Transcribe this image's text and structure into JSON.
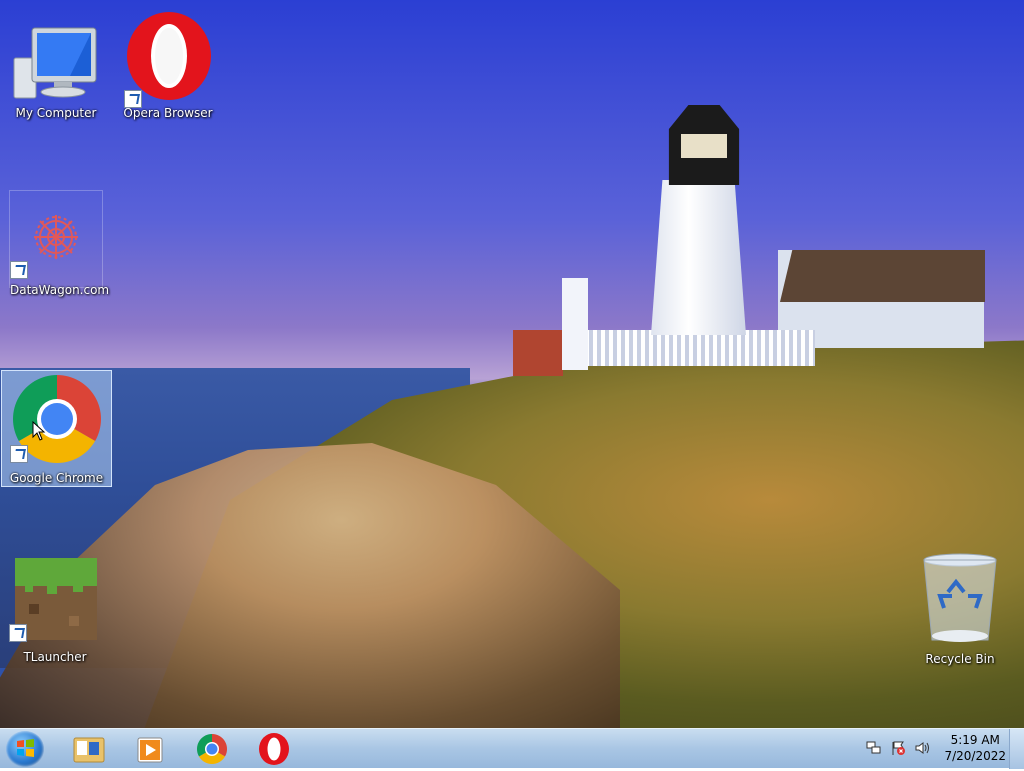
{
  "desktop": {
    "icons": [
      {
        "name": "my-computer",
        "label": "My Computer",
        "icon": "computer-icon"
      },
      {
        "name": "opera-browser",
        "label": "Opera Browser",
        "icon": "opera-icon",
        "shortcut": true
      },
      {
        "name": "datawagon",
        "label": "DataWagon.com",
        "icon": "datawagon-icon",
        "shortcut": true
      },
      {
        "name": "google-chrome",
        "label": "Google Chrome",
        "icon": "chrome-icon",
        "shortcut": true,
        "selected": true
      },
      {
        "name": "tlauncher",
        "label": "TLauncher",
        "icon": "minecraft-grass-block-icon",
        "shortcut": true
      },
      {
        "name": "recycle-bin",
        "label": "Recycle Bin",
        "icon": "recycle-bin-icon"
      }
    ]
  },
  "taskbar": {
    "start": "windows-start-icon",
    "pinned": [
      {
        "name": "file-explorer",
        "icon": "folder-icon"
      },
      {
        "name": "media-player",
        "icon": "media-player-icon"
      },
      {
        "name": "chrome",
        "icon": "chrome-icon"
      },
      {
        "name": "opera",
        "icon": "opera-icon"
      }
    ],
    "tray": [
      {
        "name": "network",
        "icon": "network-icon"
      },
      {
        "name": "action-center",
        "icon": "action-center-flag-icon"
      },
      {
        "name": "volume",
        "icon": "volume-icon"
      }
    ],
    "clock": {
      "time": "5:19 AM",
      "date": "7/20/2022"
    }
  },
  "colors": {
    "taskbar": "#a9c6e4",
    "opera_red": "#e3141c",
    "chrome_red": "#db4437",
    "chrome_green": "#0f9d58",
    "chrome_yellow": "#f4b400",
    "chrome_blue": "#4285f4"
  }
}
